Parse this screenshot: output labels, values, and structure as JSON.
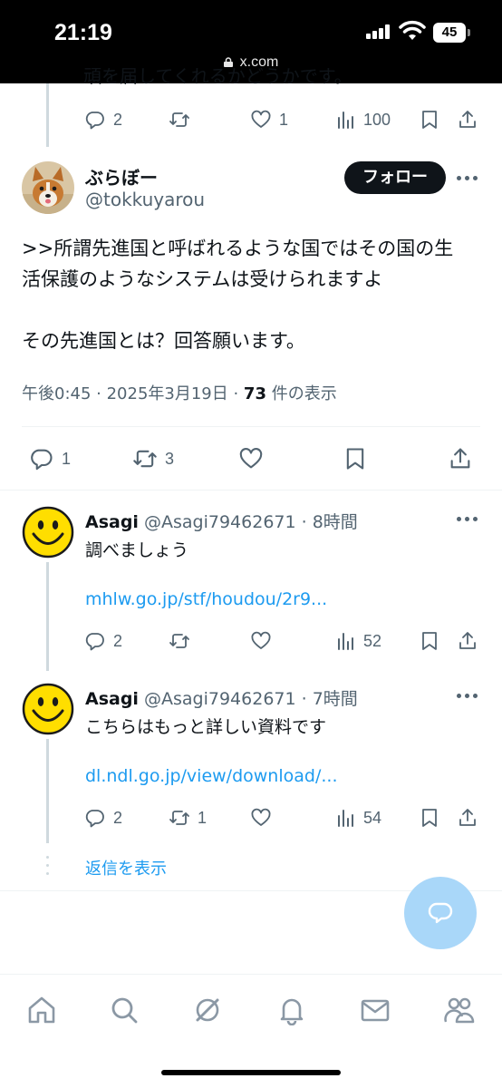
{
  "status_bar": {
    "time": "21:19",
    "battery": "45",
    "url": "x.com"
  },
  "top_tweet": {
    "clipped_text": "頑を届してくれるかどうかです。",
    "actions": {
      "replies": "2",
      "retweets": "",
      "likes": "1",
      "views": "100"
    }
  },
  "main_tweet": {
    "display_name": "ぶらぼー",
    "handle": "@tokkuyarou",
    "follow_label": "フォロー",
    "body_line1": ">>所謂先進国と呼ばれるような国ではその国の生",
    "body_line2": "活保護のようなシステムは受けられますよ",
    "body_line3": "その先進国とは？回答願います。",
    "meta_time": "午後0:45 · 2025年3月19日 · ",
    "meta_views": "73",
    "meta_views_label": " 件の表示",
    "actions": {
      "replies": "1",
      "retweets": "3"
    }
  },
  "replies": [
    {
      "name": "Asagi",
      "handle_time": " @Asagi79462671 · 8時間",
      "text": "調べましょう",
      "link": "mhlw.go.jp/stf/houdou/2r9...",
      "actions": {
        "replies": "2",
        "retweets": "",
        "likes": "",
        "views": "52"
      }
    },
    {
      "name": "Asagi",
      "handle_time": " @Asagi79462671 · 7時間",
      "text": "こちらはもっと詳しい資料です",
      "link": "dl.ndl.go.jp/view/download/...",
      "actions": {
        "replies": "2",
        "retweets": "1",
        "likes": "",
        "views": "54"
      }
    }
  ],
  "show_replies_label": "返信を表示",
  "bottom_nav": [
    "home-icon",
    "search-icon",
    "grok-icon",
    "notifications-icon",
    "messages-icon",
    "communities-icon"
  ],
  "colors": {
    "accent": "#1d9bf0",
    "text": "#0f1419",
    "secondary": "#536471",
    "fab": "#a9d7f9"
  }
}
